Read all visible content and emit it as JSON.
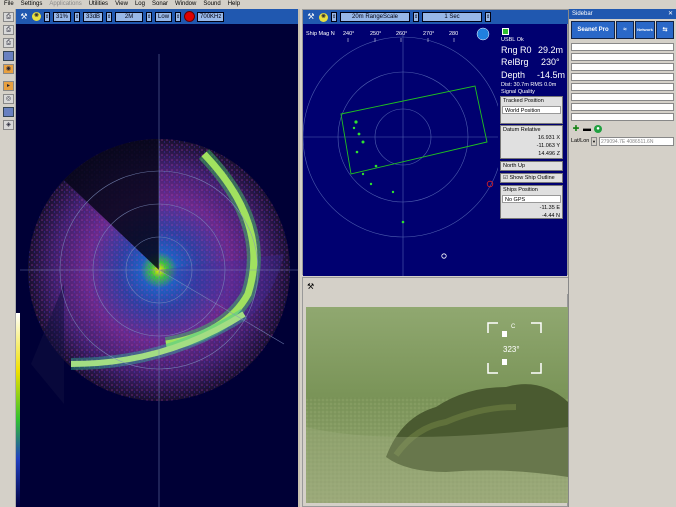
{
  "menu": [
    "File",
    "Settings",
    "Applications",
    "Utilities",
    "View",
    "Log",
    "Sonar",
    "Window",
    "Sound",
    "Help"
  ],
  "menu_disabled": [
    "Applications"
  ],
  "sonar_toolbar": {
    "gain": "31%",
    "db": "33dB",
    "range": "2M",
    "mode": "Low",
    "freq": "700KHz"
  },
  "nav": {
    "heading_mode": "Ship Mag N",
    "range_scale": "20m RangeScale",
    "interval": "1 Sec",
    "bearings": [
      "240°",
      "250°",
      "260°",
      "270°",
      "280"
    ],
    "status": "USBL Ok",
    "rng_label": "Rng R0",
    "rng_value": "29.2m",
    "relbrg_label": "RelBrg",
    "relbrg_value": "230°",
    "depth_label": "Depth",
    "depth_value": "-14.5m",
    "dist_text": "Dist: 30.7m RMS 0.0m",
    "signal_quality": "Signal Quality",
    "tracked_title": "Tracked Position",
    "world_position": "World Position",
    "datum_title": "Datum Relative",
    "datum_x": "16.931 X",
    "datum_y": "-11.063 Y",
    "datum_z": "14.496 Z",
    "orientation": "North Up",
    "show_outline": "Show Ship Outline",
    "ships_title": "Ships Position",
    "gps": "No GPS",
    "ship_e": "-11.35 E",
    "ship_n": "-4.44 N"
  },
  "video": {
    "compass_letter": "C",
    "heading": "323°"
  },
  "sidebar": {
    "title": "Sidebar",
    "close": "✕",
    "logos": [
      "Seanet Pro",
      "≈",
      "Network",
      "⇆"
    ],
    "latlon_label": "Lat/Lon",
    "latlon_value": "279094.7E 4086511.6N"
  },
  "colors": {
    "title_blue": "#2058b0",
    "nav_bg": "#000070",
    "sonar_bg": "#000036",
    "track_green": "#30e030"
  }
}
